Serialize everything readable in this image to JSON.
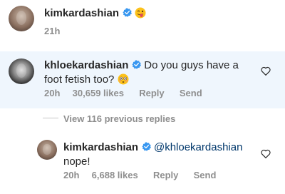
{
  "comments": [
    {
      "username": "kimkardashian",
      "text": "",
      "emoji": "tongue-out-wink",
      "time": "21h"
    },
    {
      "username": "khloekardashian",
      "text_line1": "Do you guys have a",
      "text_line2": "foot fetish too?",
      "emoji": "flushed-face",
      "time": "20h",
      "likes": "30,659 likes",
      "reply": "Reply",
      "send": "Send"
    }
  ],
  "view_replies": "View 116 previous replies",
  "reply": {
    "username": "kimkardashian",
    "mention": "@khloekardashian",
    "text": "nope!",
    "time": "20h",
    "likes": "6,688 likes",
    "reply": "Reply",
    "send": "Send"
  },
  "colors": {
    "verified": "#3897f0",
    "highlight": "#eff6fd",
    "mention": "#00376b",
    "meta": "#8e8e8e"
  }
}
